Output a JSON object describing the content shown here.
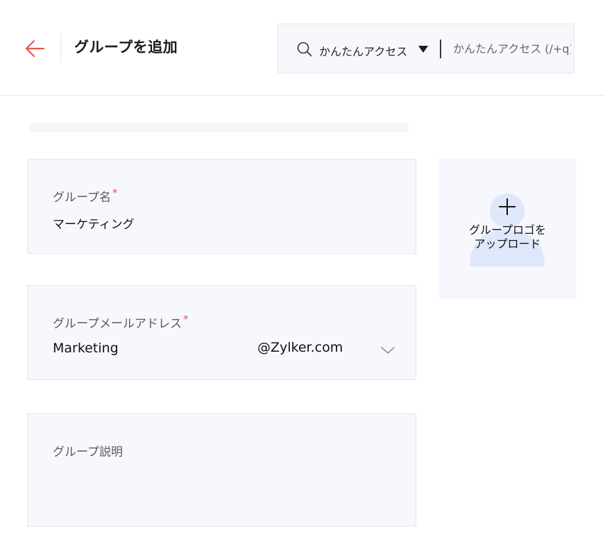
{
  "header": {
    "title": "グループを追加",
    "search": {
      "scope_label": "かんたんアクセス",
      "placeholder": "かんたんアクセス (/+q)"
    }
  },
  "progress": {
    "value": 0
  },
  "form": {
    "group_name": {
      "label": "グループ名",
      "required_mark": "*",
      "value": "マーケティング"
    },
    "group_email": {
      "label": "グループメールアドレス",
      "required_mark": "*",
      "local_part": "Marketing",
      "domain": "@Zylker.com"
    },
    "group_description": {
      "label": "グループ説明",
      "value": ""
    }
  },
  "logo_upload": {
    "line1": "グループロゴを",
    "line2": "アップロード"
  },
  "colors": {
    "accent": "#e8554e",
    "field_bg": "#f6f8fd",
    "field_border": "#e1e6f1",
    "placeholder_avatar": "#dfe7fb"
  },
  "icons": [
    "back-arrow-icon",
    "search-icon",
    "caret-down-icon",
    "chevron-down-icon",
    "plus-icon",
    "avatar-placeholder-icon"
  ]
}
